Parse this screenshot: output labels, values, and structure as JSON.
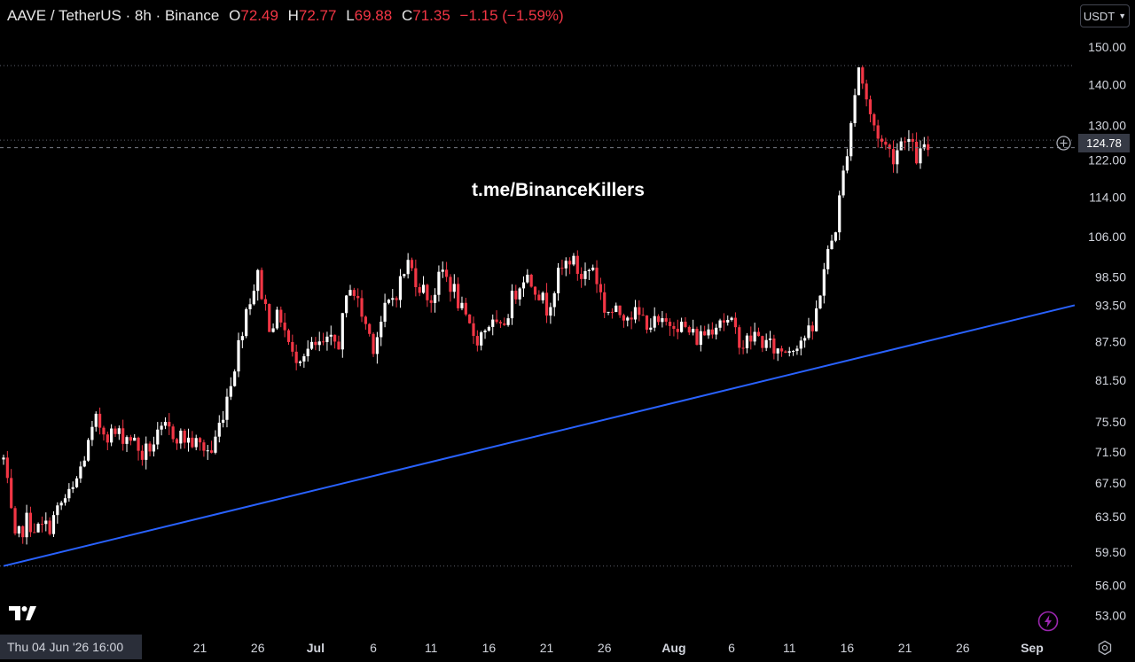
{
  "header": {
    "symbol": "AAVE / TetherUS · 8h · Binance",
    "o_label": "O",
    "o_value": "72.49",
    "h_label": "H",
    "h_value": "72.77",
    "l_label": "L",
    "l_value": "69.88",
    "c_label": "C",
    "c_value": "71.35",
    "change": "−1.15 (−1.59%)"
  },
  "currency_button": {
    "label": "USDT",
    "icon": "chevron-down-icon"
  },
  "current_price": "124.78",
  "watermark": "t.me/BinanceKillers",
  "crosshair_date": "Thu 04 Jun '26   16:00",
  "colors": {
    "up": "#ffffff",
    "down": "#f23645",
    "trendline": "#2962ff",
    "axis_text": "#d1d4dc"
  },
  "chart_data": {
    "type": "candlestick",
    "y_scale": "log",
    "ylim": [
      52,
      152
    ],
    "y_ticks": [
      "150.00",
      "140.00",
      "130.00",
      "122.00",
      "114.00",
      "106.00",
      "98.50",
      "93.50",
      "87.50",
      "81.50",
      "75.50",
      "71.50",
      "67.50",
      "63.50",
      "59.50",
      "56.00",
      "53.00"
    ],
    "x_ticks": [
      "21",
      "26",
      "Jul",
      "6",
      "11",
      "16",
      "21",
      "26",
      "Aug",
      "6",
      "11",
      "16",
      "21",
      "26",
      "Sep"
    ],
    "x_tick_bold": [
      "Jul",
      "Aug",
      "Sep"
    ],
    "horizontal_levels": [
      145,
      126.5,
      58
    ],
    "trendline": {
      "start": {
        "date": "Jun 04",
        "price": 58
      },
      "end": {
        "date": "Sep 03",
        "price": 93.5
      }
    },
    "price_path": [
      [
        "Jun 04",
        70.5
      ],
      [
        "Jun 05",
        60.5
      ],
      [
        "Jun 06",
        63
      ],
      [
        "Jun 07",
        62
      ],
      [
        "Jun 08",
        62.5
      ],
      [
        "Jun 09",
        65
      ],
      [
        "Jun 10",
        66.5
      ],
      [
        "Jun 12",
        75.5
      ],
      [
        "Jun 13",
        74
      ],
      [
        "Jun 15",
        73.5
      ],
      [
        "Jun 16",
        71
      ],
      [
        "Jun 18",
        74.5
      ],
      [
        "Jun 20",
        73
      ],
      [
        "Jun 22",
        71.5
      ],
      [
        "Jun 23",
        77
      ],
      [
        "Jun 24",
        84
      ],
      [
        "Jun 25",
        93
      ],
      [
        "Jun 26",
        98.5
      ],
      [
        "Jun 27",
        90.5
      ],
      [
        "Jun 28",
        91.5
      ],
      [
        "Jun 29",
        85
      ],
      [
        "Jun 30",
        86
      ],
      [
        "Jul 01",
        86.5
      ],
      [
        "Jul 03",
        87.5
      ],
      [
        "Jul 04",
        97.5
      ],
      [
        "Jul 05",
        92
      ],
      [
        "Jul 06",
        87
      ],
      [
        "Jul 07",
        92.5
      ],
      [
        "Jul 08",
        96
      ],
      [
        "Jul 09",
        101
      ],
      [
        "Jul 10",
        97
      ],
      [
        "Jul 11",
        94.5
      ],
      [
        "Jul 12",
        99.5
      ],
      [
        "Jul 13",
        96
      ],
      [
        "Jul 14",
        90.5
      ],
      [
        "Jul 15",
        88
      ],
      [
        "Jul 16",
        90.5
      ],
      [
        "Jul 17",
        89
      ],
      [
        "Jul 18",
        94.5
      ],
      [
        "Jul 19",
        99
      ],
      [
        "Jul 20",
        97
      ],
      [
        "Jul 21",
        93
      ],
      [
        "Jul 22",
        98.5
      ],
      [
        "Jul 23",
        102
      ],
      [
        "Jul 24",
        98.5
      ],
      [
        "Jul 25",
        100.5
      ],
      [
        "Jul 26",
        93
      ],
      [
        "Jul 27",
        92
      ],
      [
        "Jul 28",
        92.5
      ],
      [
        "Jul 29",
        91.5
      ],
      [
        "Jul 30",
        90.5
      ],
      [
        "Jul 31",
        90
      ],
      [
        "Aug 01",
        91
      ],
      [
        "Aug 02",
        89.5
      ],
      [
        "Aug 03",
        88
      ],
      [
        "Aug 04",
        89.5
      ],
      [
        "Aug 05",
        91.5
      ],
      [
        "Aug 06",
        90
      ],
      [
        "Aug 07",
        87
      ],
      [
        "Aug 08",
        88.5
      ],
      [
        "Aug 09",
        87
      ],
      [
        "Aug 10",
        86
      ],
      [
        "Aug 11",
        86.5
      ],
      [
        "Aug 12",
        88
      ],
      [
        "Aug 13",
        89
      ],
      [
        "Aug 14",
        100
      ],
      [
        "Aug 15",
        108
      ],
      [
        "Aug 16",
        124.78
      ],
      [
        "Aug 17",
        145
      ],
      [
        "Aug 18",
        132
      ],
      [
        "Aug 19",
        126
      ],
      [
        "Aug 20",
        123
      ],
      [
        "Aug 21",
        128
      ],
      [
        "Aug 22",
        122.5
      ],
      [
        "Aug 23",
        124.78
      ]
    ]
  }
}
